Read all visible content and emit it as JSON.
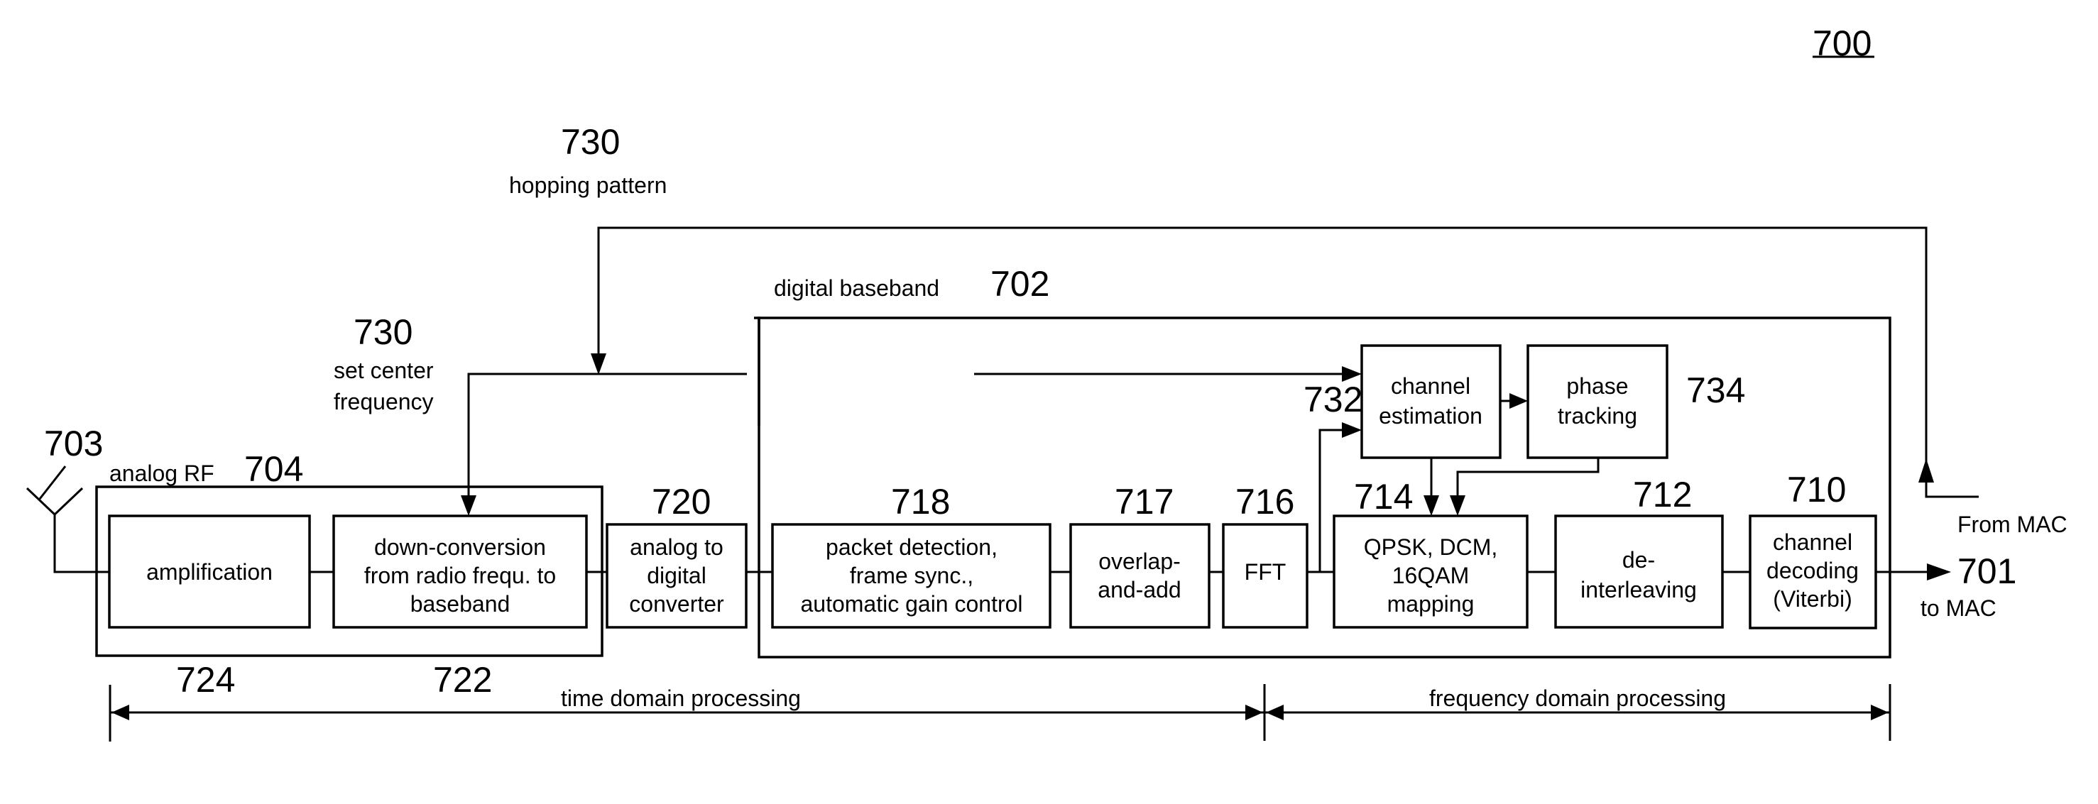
{
  "figure": {
    "number": "700",
    "hopping": {
      "ref": "730",
      "label": "hopping pattern"
    },
    "center_freq": {
      "ref": "730",
      "label_lines": [
        "set center",
        "frequency"
      ]
    },
    "antenna": {
      "ref": "703"
    },
    "analog_rf": {
      "label": "analog RF",
      "ref": "704"
    },
    "digital_baseband": {
      "label": "digital baseband",
      "ref": "702"
    },
    "blocks": {
      "amplification": {
        "lines": [
          "amplification"
        ],
        "ref": "724"
      },
      "downconversion": {
        "lines": [
          "down-conversion",
          "from radio frequ. to",
          "baseband"
        ],
        "ref": "722"
      },
      "adc": {
        "lines": [
          "analog to",
          "digital",
          "converter"
        ],
        "ref": "720"
      },
      "packet": {
        "lines": [
          "packet detection,",
          "frame sync.,",
          "automatic gain control"
        ],
        "ref": "718"
      },
      "overlap": {
        "lines": [
          "overlap-",
          "and-add"
        ],
        "ref": "717"
      },
      "fft": {
        "lines": [
          "FFT"
        ],
        "ref": "716"
      },
      "mapping": {
        "lines": [
          "QPSK, DCM,",
          "16QAM",
          "mapping"
        ],
        "ref": "714"
      },
      "deinterleave": {
        "lines": [
          "de-",
          "interleaving"
        ],
        "ref": "712"
      },
      "decoding": {
        "lines": [
          "channel",
          "decoding",
          "(Viterbi)"
        ],
        "ref": "710"
      },
      "chan_est": {
        "lines": [
          "channel",
          "estimation"
        ],
        "ref": "732"
      },
      "phase": {
        "lines": [
          "phase",
          "tracking"
        ],
        "ref": "734"
      }
    },
    "output": {
      "ref": "701",
      "label": "to MAC"
    },
    "input": {
      "label": "From MAC"
    },
    "domains": {
      "time": "time domain processing",
      "frequency": "frequency domain processing"
    }
  }
}
